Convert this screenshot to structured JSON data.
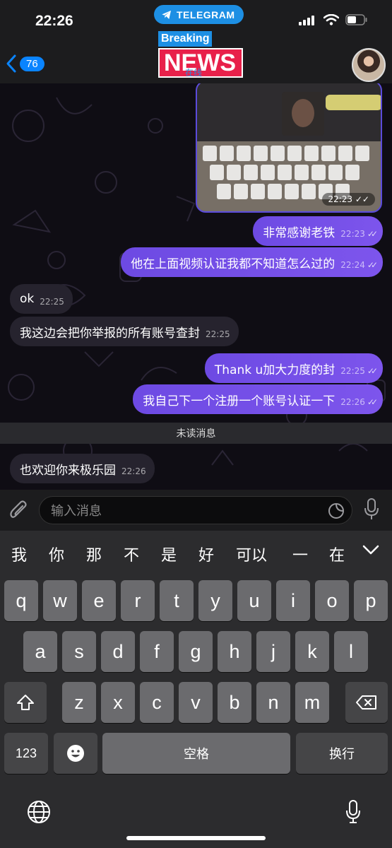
{
  "status_bar": {
    "time": "22:26",
    "telegram_label": "TELEGRAM"
  },
  "header": {
    "back_count": "76",
    "logo_top": "Breaking",
    "logo_bottom": "NEWS",
    "subtitle": "在线"
  },
  "messages": [
    {
      "dir": "out",
      "text": "非常感谢老铁",
      "time": "22:23"
    },
    {
      "dir": "out",
      "text": "他在上面视频认证我都不知道怎么过的",
      "time": "22:24"
    },
    {
      "dir": "in",
      "text": "ok",
      "time": "22:25"
    },
    {
      "dir": "in",
      "text": "我这边会把你举报的所有账号查封",
      "time": "22:25"
    },
    {
      "dir": "out",
      "text": "Thank u加大力度的封",
      "time": "22:25"
    },
    {
      "dir": "out",
      "text": "我自己下一个注册一个账号认证一下",
      "time": "22:26"
    },
    {
      "dir": "in",
      "text": "也欢迎你来极乐园",
      "time": "22:26"
    }
  ],
  "photo": {
    "time": "22:23"
  },
  "unread_label": "未读消息",
  "input": {
    "placeholder": "输入消息"
  },
  "keyboard": {
    "candidates": [
      "我",
      "你",
      "那",
      "不",
      "是",
      "好",
      "可以",
      "一",
      "在"
    ],
    "row1": [
      "q",
      "w",
      "e",
      "r",
      "t",
      "y",
      "u",
      "i",
      "o",
      "p"
    ],
    "row2": [
      "a",
      "s",
      "d",
      "f",
      "g",
      "h",
      "j",
      "k",
      "l"
    ],
    "row3": [
      "z",
      "x",
      "c",
      "v",
      "b",
      "n",
      "m"
    ],
    "numbers_label": "123",
    "space_label": "空格",
    "return_label": "换行"
  },
  "colors": {
    "outgoing_bubble": "#7150e8",
    "incoming_bubble": "#26232e",
    "telegram_blue": "#1d8fe4"
  }
}
